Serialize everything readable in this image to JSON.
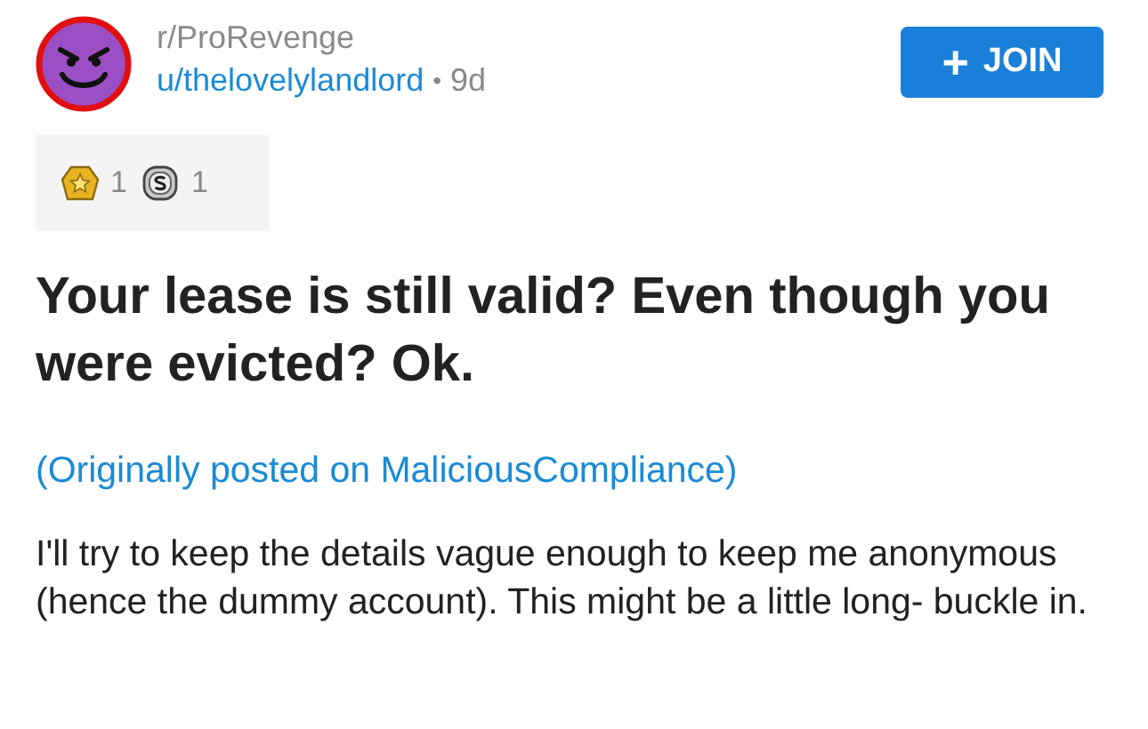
{
  "header": {
    "subreddit": "r/ProRevenge",
    "author": "u/thelovelylandlord",
    "separator": "•",
    "age": "9d"
  },
  "join_button": {
    "label": "JOIN",
    "icon": "+"
  },
  "awards": [
    {
      "kind": "gold",
      "count": "1"
    },
    {
      "kind": "silver",
      "count": "1"
    }
  ],
  "title": "Your lease is still valid? Even though you were evicted? Ok.",
  "link": "(Originally posted on MaliciousCompliance)",
  "body": "I'll try to keep the details vague enough to keep me anonymous (hence the dummy account). This might be a little long- buckle in."
}
